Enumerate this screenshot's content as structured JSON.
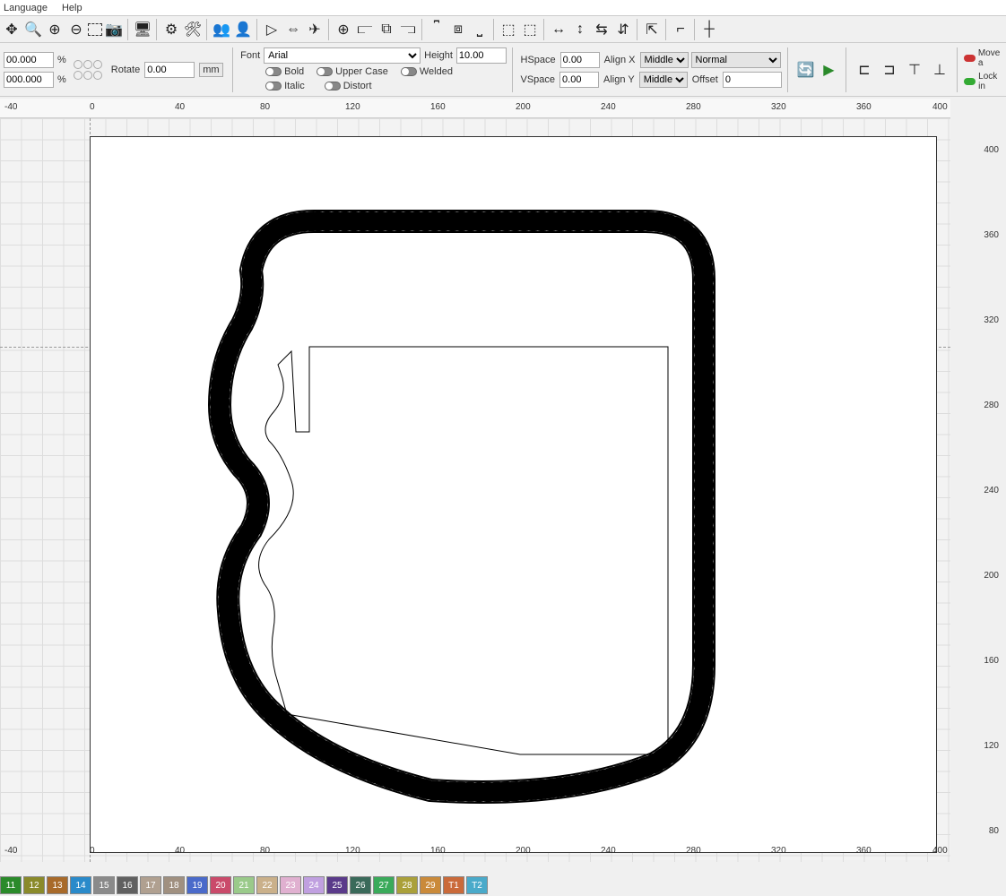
{
  "menu": {
    "language": "Language",
    "help": "Help"
  },
  "row2_left": {
    "x": "00.000",
    "y": "000.000",
    "pct": "%",
    "rotate_label": "Rotate",
    "rotate": "0.00",
    "unit": "mm"
  },
  "font": {
    "label": "Font",
    "name": "Arial",
    "height_label": "Height",
    "height": "10.00",
    "bold": "Bold",
    "italic": "Italic",
    "uppercase": "Upper Case",
    "distort": "Distort",
    "welded": "Welded"
  },
  "spacing": {
    "hspace_label": "HSpace",
    "hspace": "0.00",
    "vspace_label": "VSpace",
    "vspace": "0.00",
    "alignx_label": "Align X",
    "alignx": "Middle",
    "aligny_label": "Align Y",
    "aligny": "Middle",
    "normal": "Normal",
    "offset_label": "Offset",
    "offset": "0"
  },
  "right_opts": {
    "move": "Move a",
    "lock": "Lock in"
  },
  "ruler_top": [
    "-40",
    "0",
    "40",
    "80",
    "120",
    "160",
    "200",
    "240",
    "280",
    "320",
    "360",
    "400"
  ],
  "ruler_bottom": [
    "-40",
    "0",
    "40",
    "80",
    "120",
    "160",
    "200",
    "240",
    "280",
    "320",
    "360",
    "400"
  ],
  "ruler_right": [
    "400",
    "360",
    "320",
    "280",
    "240",
    "200",
    "160",
    "120",
    "80"
  ],
  "palette": [
    "11",
    "12",
    "13",
    "14",
    "15",
    "16",
    "17",
    "18",
    "19",
    "20",
    "21",
    "22",
    "23",
    "24",
    "25",
    "26",
    "27",
    "28",
    "29",
    "T1",
    "T2"
  ],
  "palette_colors": [
    "#2a8a2a",
    "#8a8a2a",
    "#a86a2a",
    "#2a8aca",
    "#8a8a8a",
    "#606060",
    "#b0a090",
    "#a09080",
    "#4a6aca",
    "#ca4a6a",
    "#9aca8a",
    "#cab08a",
    "#e0b0d0",
    "#c0a0e0",
    "#5a3a8a",
    "#3a6a5a",
    "#3aaa5a",
    "#aaa03a",
    "#ca8a3a",
    "#ca6a3a",
    "#4aaaca"
  ]
}
